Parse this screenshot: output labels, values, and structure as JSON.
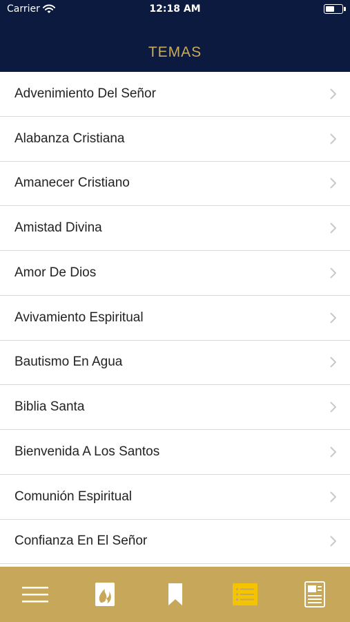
{
  "status_bar": {
    "carrier": "Carrier",
    "time": "12:18 AM",
    "battery_level": 0.5
  },
  "header": {
    "title": "TEMAS"
  },
  "topics": [
    {
      "label": "Advenimiento Del Señor"
    },
    {
      "label": "Alabanza Cristiana"
    },
    {
      "label": "Amanecer Cristiano"
    },
    {
      "label": "Amistad Divina"
    },
    {
      "label": "Amor De Dios"
    },
    {
      "label": "Avivamiento Espiritual"
    },
    {
      "label": "Bautismo En Agua"
    },
    {
      "label": "Biblia Santa"
    },
    {
      "label": "Bienvenida A Los Santos"
    },
    {
      "label": "Comunión Espiritual"
    },
    {
      "label": "Confianza En El Señor"
    }
  ],
  "tabbar": {
    "tabs": [
      {
        "icon": "hamburger-menu-icon"
      },
      {
        "icon": "hymnal-flame-icon"
      },
      {
        "icon": "bookmark-icon"
      },
      {
        "icon": "topics-list-icon",
        "selected": true
      },
      {
        "icon": "document-icon"
      }
    ],
    "colors": {
      "background": "#c7a85a",
      "icon": "#ffffff",
      "active_icon": "#f5c400"
    }
  },
  "colors": {
    "header_bg": "#0b1a3e",
    "title": "#c9ab5c",
    "divider": "#d9d9d9",
    "chevron": "#c7c7cc"
  }
}
